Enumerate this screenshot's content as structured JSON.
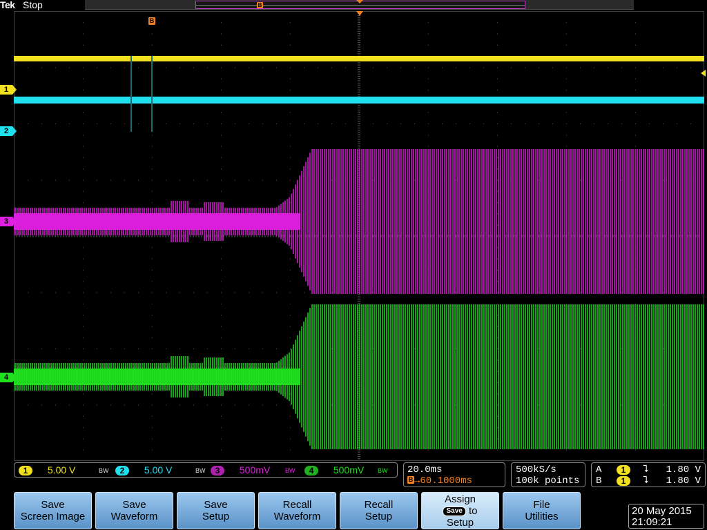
{
  "header": {
    "brand": "Tek",
    "status": "Stop",
    "record_marker": "B",
    "trigger_marker": "B"
  },
  "channels": [
    {
      "id": "1",
      "color": "#f0e020",
      "scale": "5.00 V",
      "bw": "BW"
    },
    {
      "id": "2",
      "color": "#20e0f0",
      "scale": "5.00 V",
      "bw": "BW"
    },
    {
      "id": "3",
      "color": "#e020e0",
      "scale": "500mV",
      "bw": "BW"
    },
    {
      "id": "4",
      "color": "#20e020",
      "scale": "500mV",
      "bw": "BW"
    }
  ],
  "timebase": {
    "scale": "20.0ms",
    "delay_marker": "B",
    "delay": "→60.1000ms"
  },
  "acquisition": {
    "rate": "500kS/s",
    "points": "100k points"
  },
  "triggers": [
    {
      "label": "A",
      "source": "1",
      "slope": "⮧",
      "level": "1.80 V"
    },
    {
      "label": "B",
      "source": "1",
      "slope": "⮧",
      "level": "1.80 V"
    }
  ],
  "buttons": [
    {
      "line1": "Save",
      "line2": "Screen Image"
    },
    {
      "line1": "Save",
      "line2": "Waveform"
    },
    {
      "line1": "Save",
      "line2": "Setup"
    },
    {
      "line1": "Recall",
      "line2": "Waveform"
    },
    {
      "line1": "Recall",
      "line2": "Setup"
    },
    {
      "line1": "Assign",
      "chip": "Save",
      "mid": "to",
      "line2": "Setup"
    },
    {
      "line1": "File",
      "line2": "Utilities"
    }
  ],
  "datetime": {
    "date": "20 May 2015",
    "time": "21:09:21"
  }
}
